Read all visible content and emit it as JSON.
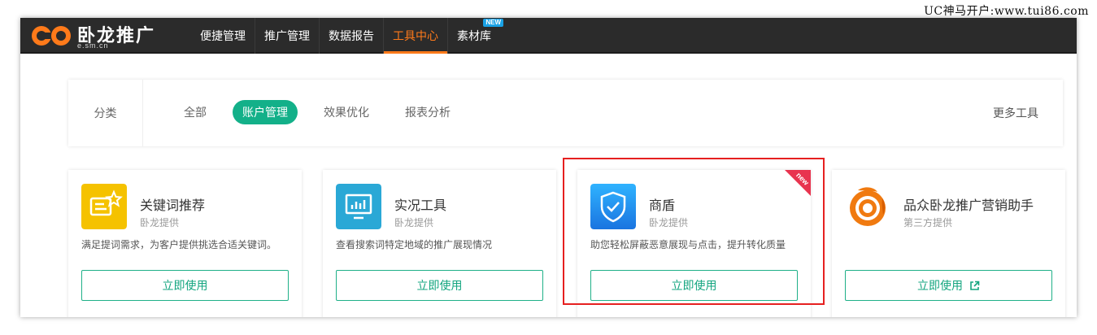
{
  "watermark": "UC神马开户:www.tui86.com",
  "logo": {
    "title": "卧龙推广",
    "subtitle": "e.sm.cn"
  },
  "nav": {
    "items": [
      {
        "label": "便捷管理"
      },
      {
        "label": "推广管理"
      },
      {
        "label": "数据报告"
      },
      {
        "label": "工具中心",
        "active": true
      },
      {
        "label": "素材库",
        "badge": "NEW"
      }
    ]
  },
  "filter": {
    "label": "分类",
    "tabs": [
      {
        "label": "全部"
      },
      {
        "label": "账户管理",
        "active": true
      },
      {
        "label": "效果优化"
      },
      {
        "label": "报表分析"
      }
    ],
    "more": "更多工具"
  },
  "cards": [
    {
      "title": "关键词推荐",
      "provider": "卧龙提供",
      "desc": "满足提词需求，为客户提供挑选合适关键词。",
      "button": "立即使用",
      "icon": "keyword-star-icon",
      "icon_color": "#f5c200"
    },
    {
      "title": "实况工具",
      "provider": "卧龙提供",
      "desc": "查看搜索词特定地域的推广展现情况",
      "button": "立即使用",
      "icon": "live-monitor-icon",
      "icon_color": "#2aa8d6"
    },
    {
      "title": "商盾",
      "provider": "卧龙提供",
      "desc": "助您轻松屏蔽恶意展现与点击，提升转化质量",
      "button": "立即使用",
      "icon": "shield-check-icon",
      "icon_color": "#1a8ef0",
      "corner_badge": "new"
    },
    {
      "title": "品众卧龙推广营销助手",
      "provider": "第三方提供",
      "desc": "",
      "button": "立即使用",
      "icon": "dragon-logo-icon",
      "icon_color": "#f07a10",
      "external": true
    }
  ],
  "colors": {
    "nav_bg": "#2b2b2b",
    "accent_orange": "#ff7a1a",
    "accent_green": "#13b089",
    "highlight_red": "#e62020"
  }
}
